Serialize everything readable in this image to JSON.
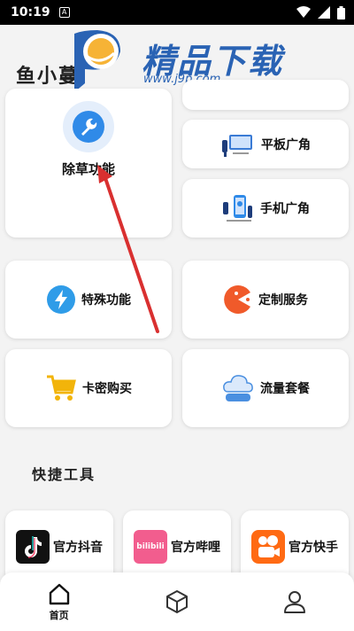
{
  "status_bar": {
    "time": "10:19",
    "notification_glyph": "A"
  },
  "header": {
    "app_title": "鱼小蔓"
  },
  "watermark": {
    "title": "精品下载",
    "url": "www.j9p.com",
    "color": "#2a63b4"
  },
  "features": {
    "weeding": {
      "label": "除草功能",
      "icon": "wrench-icon",
      "icon_color": "#2f8ae8"
    },
    "tablet_wide": {
      "label": "平板广角",
      "icon": "tablet-icon"
    },
    "phone_wide": {
      "label": "手机广角",
      "icon": "phone-icon"
    },
    "special": {
      "label": "特殊功能",
      "icon": "lightning-icon",
      "icon_color": "#2f9ce8"
    },
    "custom_service": {
      "label": "定制服务",
      "icon": "pacman-icon",
      "icon_color": "#f05a2a"
    },
    "card_purchase": {
      "label": "卡密购买",
      "icon": "cart-icon",
      "icon_color": "#f2b40a"
    },
    "data_package": {
      "label": "流量套餐",
      "icon": "cloud-icon",
      "icon_color": "#4a8fe0"
    }
  },
  "quick_tools": {
    "title": "快捷工具",
    "items": [
      {
        "label": "官方抖音",
        "icon": "douyin-icon"
      },
      {
        "label": "官方哔哩",
        "icon": "bilibili-icon",
        "icon_text": "bilibili"
      },
      {
        "label": "官方快手",
        "icon": "kuaishou-icon"
      }
    ]
  },
  "bottom_nav": {
    "items": [
      {
        "label": "首页",
        "icon": "home-icon"
      },
      {
        "label": "",
        "icon": "cube-icon"
      },
      {
        "label": "",
        "icon": "user-icon"
      }
    ]
  },
  "annotation_color": "#d93030"
}
